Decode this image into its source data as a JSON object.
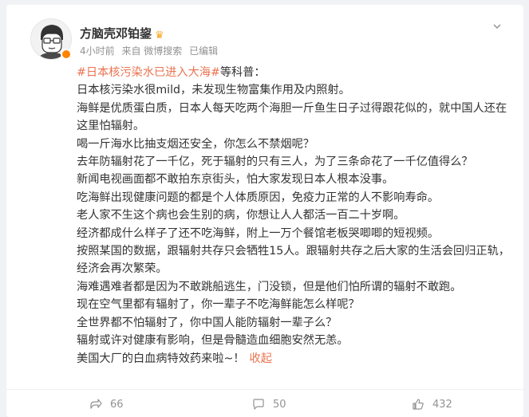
{
  "post": {
    "author": "方脑壳邓铂鋆",
    "time": "4小时前",
    "source": "来自 微博搜索",
    "edited": "已编辑",
    "topic": "#日本核污染水已进入大海#",
    "intro": "等科普：",
    "paragraphs": [
      "日本核污染水很mild，未发现生物富集作用及内照射。",
      "海鲜是优质蛋白质，日本人每天吃两个海胆一斤鱼生日子过得跟花似的，就中国人还在这里怕辐射。",
      "喝一斤海水比抽支烟还安全，你怎么不禁烟呢？",
      "去年防辐射花了一千亿，死于辐射的只有三人，为了三条命花了一千亿值得么？",
      "新闻电视画面都不敢拍东京街头，怕大家发现日本人根本没事。",
      "吃海鲜出现健康问题的都是个人体质原因，免疫力正常的人不影响寿命。",
      "老人家不生这个病也会生别的病，你想让人人都活一百二十岁啊。",
      "经济都成什么样子了还不吃海鲜，附上一万个餐馆老板哭唧唧的短视频。",
      "按照某国的数据，跟辐射共存只会牺牲15人。跟辐射共存之后大家的生活会回归正轨，经济会再次繁荣。",
      "海难遇难者都是因为不敢跳船逃生，门没锁，但是他们怕所谓的辐射不敢跑。",
      "现在空气里都有辐射了，你一辈子不吃海鲜能怎么样呢？",
      "全世界都不怕辐射了，你中国人能防辐射一辈子么？",
      "辐射或许对健康有影响，但是骨髓造血细胞安然无恙。"
    ],
    "last_line": "美国大厂的白血病特效药来啦~！",
    "collapse_label": "收起"
  },
  "actions": {
    "share_count": "66",
    "comment_count": "50",
    "like_count": "432"
  },
  "colors": {
    "topic": "#eb7350",
    "muted": "#939393",
    "verified": "#ff8200"
  },
  "icons": {
    "avatar": "cartoon-portrait-avatar",
    "verified": "verified-badge-icon",
    "vip": "crown-icon",
    "more": "chevron-down-icon",
    "share": "share-icon",
    "comment": "comment-icon",
    "like": "thumbs-up-icon"
  }
}
